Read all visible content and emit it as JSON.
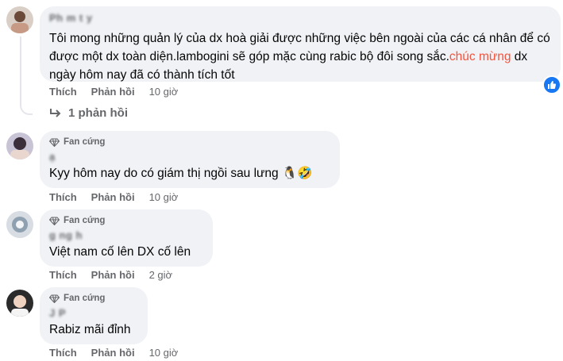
{
  "comments": [
    {
      "name": "Ph m  t y  ",
      "text_before": "Tôi mong những quản lý của dx hoà giải được những việc bên ngoài của các cá nhân để có được một dx toàn diện.lambogini sẽ góp mặc cùng rabic bộ đôi song sắc.",
      "text_highlight": "chúc mừng",
      "text_after": " dx ngày hôm nay đã có thành tích tốt",
      "reactions": "like",
      "like_label": "Thích",
      "reply_label": "Phản hồi",
      "time": "10 giờ",
      "replies_label": "1 phản hồi"
    },
    {
      "badge": "Fan cứng",
      "name": "  ạ    ",
      "text": "Kyy hôm nay do có giám thị ngồi sau lưng 🐧🤣",
      "like_label": "Thích",
      "reply_label": "Phản hồi",
      "time": "10 giờ"
    },
    {
      "badge": "Fan cứng",
      "name": "    g   ng   h",
      "text": "Việt nam cố lên DX cố lên",
      "like_label": "Thích",
      "reply_label": "Phản hồi",
      "time": "2 giờ"
    },
    {
      "badge": "Fan cứng",
      "name": "J   P  ",
      "text": "Rabiz mãi đỉnh",
      "like_label": "Thích",
      "reply_label": "Phản hồi",
      "time": "10 giờ"
    }
  ],
  "colors": {
    "bubble": "#f0f2f5",
    "meta": "#65676b",
    "highlight": "#f5533d",
    "like_blue": "#1877f2"
  }
}
